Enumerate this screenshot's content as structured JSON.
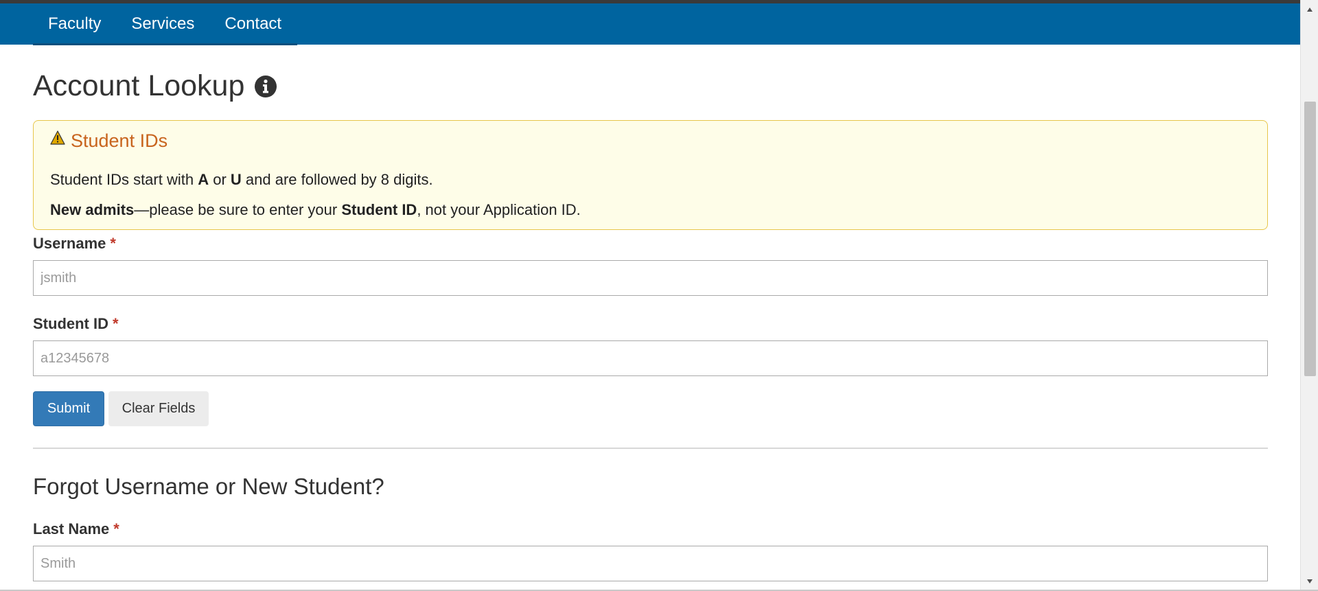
{
  "nav": {
    "items": [
      "Faculty",
      "Services",
      "Contact"
    ]
  },
  "page": {
    "title": "Account Lookup",
    "title_icon": "info-circle-icon"
  },
  "alert": {
    "icon": "warning-triangle-icon",
    "title": "Student IDs",
    "line1": {
      "prefix": "Student IDs start with ",
      "letter_a": "A",
      "or": " or ",
      "letter_u": "U",
      "suffix": " and are followed by 8 digits."
    },
    "line2": {
      "bold_lead": "New admits",
      "middle": "—please be sure to enter your ",
      "bold_id": "Student ID",
      "suffix": ", not your Application ID."
    }
  },
  "form": {
    "username": {
      "label": "Username",
      "required_mark": "*",
      "placeholder": "jsmith"
    },
    "student_id": {
      "label": "Student ID",
      "required_mark": "*",
      "placeholder": "a12345678"
    },
    "submit_label": "Submit",
    "clear_label": "Clear Fields"
  },
  "forgot": {
    "title": "Forgot Username or New Student?",
    "last_name": {
      "label": "Last Name",
      "required_mark": "*",
      "placeholder": "Smith"
    }
  },
  "colors": {
    "navbar": "#00649f",
    "alert_bg": "#fefde8",
    "alert_border": "#e7c64a",
    "alert_title": "#c8641d",
    "required": "#c0392b",
    "submit_button": "#337ab7"
  }
}
